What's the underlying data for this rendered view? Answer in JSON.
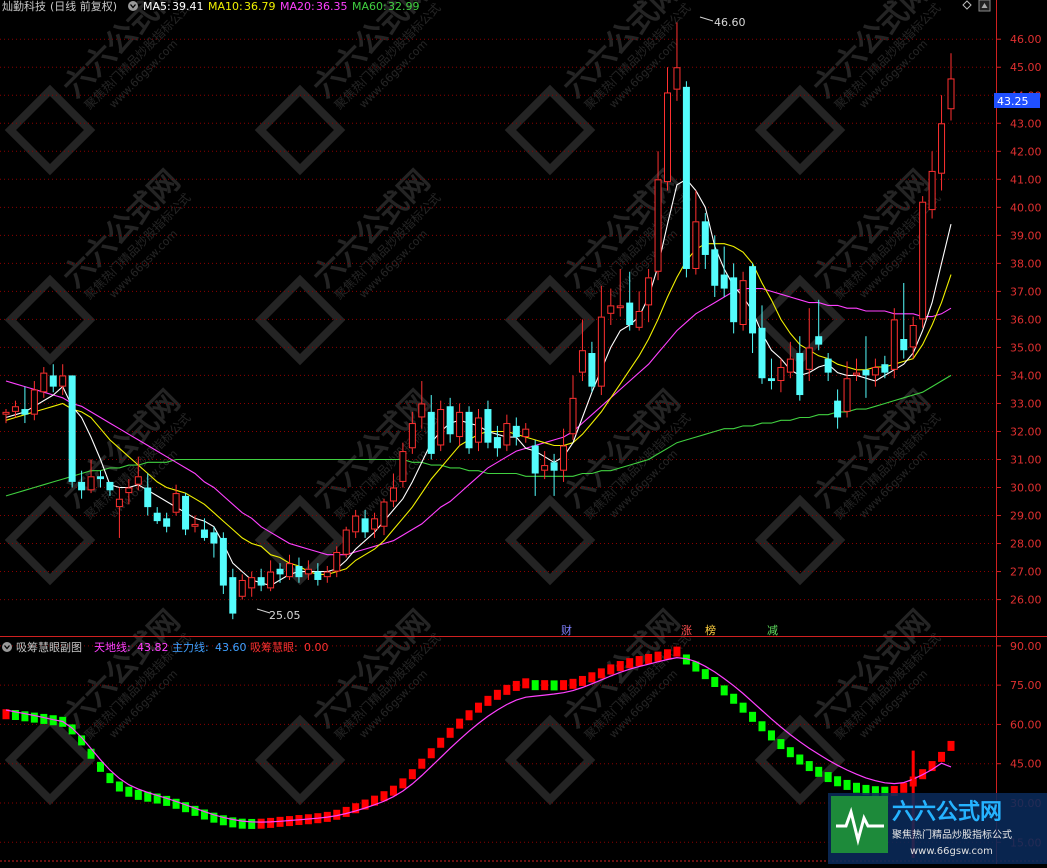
{
  "main_header": {
    "stock_name": "灿勤科技",
    "period": "(日线 前复权)",
    "ma": [
      {
        "label": "MA5:",
        "value": "39.41",
        "color": "#ffffff"
      },
      {
        "label": "MA10:",
        "value": "36.79",
        "color": "#f0f000"
      },
      {
        "label": "MA20:",
        "value": "36.35",
        "color": "#ff40ff"
      },
      {
        "label": "MA60:",
        "value": "32.99",
        "color": "#40d040"
      }
    ]
  },
  "sub_header": {
    "title": "吸筹慧眼副图",
    "items": [
      {
        "label": "天地线:",
        "value": "43.82",
        "color": "#ff40ff"
      },
      {
        "label": "主力线:",
        "value": "43.60",
        "color": "#40a0ff"
      },
      {
        "label": "吸筹慧眼:",
        "value": "0.00",
        "color": "#ff3030"
      }
    ]
  },
  "current_price_tag": "43.25",
  "annotations": {
    "high": "46.60",
    "low": "25.05",
    "markers": [
      "财",
      "涨",
      "榜",
      "减"
    ]
  },
  "watermark": {
    "brand": "六六公式网",
    "slogan": "聚焦热门精品炒股指标公式",
    "url": "www.66gsw.com"
  },
  "colors": {
    "up": "#ff3030",
    "down": "#54fcfc",
    "grid": "#8b0000",
    "axis": "#d02020",
    "ma5": "#ffffff",
    "ma10": "#f0f000",
    "ma20": "#ff40ff",
    "ma60": "#40d040",
    "sub_up": "#ff0000",
    "sub_down": "#00ff00"
  },
  "chart_data": [
    {
      "type": "candlestick",
      "title": "灿勤科技",
      "ylim": [
        24.7,
        46.9
      ],
      "y_ticks": [
        "26.00",
        "27.00",
        "28.00",
        "29.00",
        "30.00",
        "31.00",
        "32.00",
        "33.00",
        "34.00",
        "35.00",
        "36.00",
        "37.00",
        "38.00",
        "39.00",
        "40.00",
        "41.00",
        "42.00",
        "43.00",
        "44.00",
        "45.00",
        "46.00"
      ],
      "candles": [
        [
          32.6,
          32.7,
          32.3,
          32.8
        ],
        [
          32.7,
          32.9,
          32.5,
          33.1
        ],
        [
          32.8,
          32.6,
          32.3,
          33.6
        ],
        [
          32.6,
          33.5,
          32.4,
          33.8
        ],
        [
          33.4,
          34.1,
          33.2,
          34.3
        ],
        [
          34.0,
          33.6,
          33.4,
          34.4
        ],
        [
          33.6,
          34.0,
          33.3,
          34.4
        ],
        [
          34.0,
          30.2,
          30.0,
          34.0
        ],
        [
          30.2,
          29.9,
          29.6,
          30.6
        ],
        [
          29.9,
          30.4,
          29.8,
          31.0
        ],
        [
          30.4,
          30.3,
          30.0,
          30.6
        ],
        [
          30.2,
          29.9,
          29.7,
          30.1
        ],
        [
          29.3,
          29.6,
          28.2,
          30.0
        ],
        [
          29.8,
          30.0,
          29.4,
          30.3
        ],
        [
          30.1,
          30.4,
          29.9,
          31.1
        ],
        [
          30.0,
          29.3,
          29.0,
          30.5
        ],
        [
          29.1,
          28.8,
          28.7,
          29.3
        ],
        [
          28.9,
          28.6,
          28.4,
          29.1
        ],
        [
          29.1,
          29.8,
          29.0,
          30.1
        ],
        [
          29.7,
          28.5,
          28.3,
          29.8
        ],
        [
          28.6,
          28.7,
          28.4,
          29.0
        ],
        [
          28.5,
          28.2,
          28.1,
          28.9
        ],
        [
          28.4,
          28.0,
          27.5,
          28.6
        ],
        [
          28.2,
          26.5,
          26.2,
          28.4
        ],
        [
          26.8,
          25.5,
          25.3,
          27.1
        ],
        [
          26.1,
          26.7,
          26.0,
          26.9
        ],
        [
          26.4,
          26.8,
          26.1,
          27.0
        ],
        [
          26.8,
          26.5,
          26.3,
          27.1
        ],
        [
          26.4,
          27.0,
          26.3,
          27.4
        ],
        [
          27.1,
          26.9,
          26.6,
          27.3
        ],
        [
          26.8,
          27.3,
          26.7,
          27.6
        ],
        [
          27.2,
          26.8,
          26.6,
          27.5
        ],
        [
          26.9,
          27.1,
          26.7,
          27.4
        ],
        [
          27.0,
          26.7,
          26.5,
          27.3
        ],
        [
          26.8,
          27.0,
          26.6,
          27.2
        ],
        [
          27.0,
          27.7,
          26.8,
          27.9
        ],
        [
          27.6,
          28.5,
          27.5,
          28.6
        ],
        [
          28.4,
          29.0,
          28.2,
          29.2
        ],
        [
          28.9,
          28.4,
          28.2,
          29.2
        ],
        [
          28.5,
          28.9,
          28.2,
          29.1
        ],
        [
          28.6,
          29.5,
          28.3,
          29.6
        ],
        [
          29.5,
          30.0,
          29.3,
          30.5
        ],
        [
          30.2,
          31.3,
          30.0,
          31.6
        ],
        [
          31.4,
          32.3,
          31.2,
          32.7
        ],
        [
          32.5,
          33.0,
          32.1,
          33.8
        ],
        [
          32.7,
          31.2,
          31.0,
          33.3
        ],
        [
          31.5,
          32.8,
          31.3,
          33.1
        ],
        [
          32.9,
          31.9,
          31.6,
          33.2
        ],
        [
          31.8,
          32.7,
          31.5,
          33.0
        ],
        [
          32.7,
          31.4,
          31.2,
          32.9
        ],
        [
          31.6,
          32.5,
          31.3,
          32.8
        ],
        [
          32.8,
          31.6,
          31.4,
          33.1
        ],
        [
          31.8,
          31.4,
          31.1,
          32.2
        ],
        [
          31.5,
          32.3,
          31.3,
          32.6
        ],
        [
          32.2,
          31.8,
          31.5,
          32.5
        ],
        [
          31.8,
          32.1,
          31.6,
          32.3
        ],
        [
          31.5,
          30.5,
          29.7,
          31.7
        ],
        [
          30.6,
          30.8,
          30.3,
          31.3
        ],
        [
          30.9,
          30.6,
          29.7,
          31.2
        ],
        [
          30.6,
          31.5,
          30.2,
          32.1
        ],
        [
          31.9,
          33.2,
          31.7,
          34.0
        ],
        [
          34.1,
          34.9,
          33.8,
          36.0
        ],
        [
          34.8,
          33.6,
          33.4,
          35.2
        ],
        [
          33.6,
          36.1,
          33.3,
          37.2
        ],
        [
          36.2,
          36.5,
          35.8,
          37.1
        ],
        [
          36.4,
          36.5,
          36.1,
          37.8
        ],
        [
          36.6,
          35.8,
          35.6,
          37.7
        ],
        [
          35.7,
          36.3,
          35.6,
          37.0
        ],
        [
          36.5,
          37.5,
          35.9,
          37.8
        ],
        [
          37.7,
          41.0,
          37.4,
          42.0
        ],
        [
          40.9,
          44.1,
          40.6,
          45.0
        ],
        [
          44.2,
          45.0,
          43.8,
          46.6
        ],
        [
          44.3,
          37.8,
          37.5,
          44.5
        ],
        [
          37.8,
          39.5,
          37.6,
          40.6
        ],
        [
          39.5,
          38.3,
          37.8,
          39.8
        ],
        [
          38.5,
          37.2,
          36.8,
          39.0
        ],
        [
          37.6,
          37.1,
          36.8,
          38.6
        ],
        [
          37.5,
          35.9,
          35.5,
          38.0
        ],
        [
          35.8,
          37.4,
          35.6,
          37.7
        ],
        [
          37.9,
          35.5,
          34.8,
          38.0
        ],
        [
          35.7,
          33.9,
          33.7,
          36.5
        ],
        [
          33.9,
          33.8,
          33.5,
          34.6
        ],
        [
          33.8,
          34.3,
          33.4,
          34.6
        ],
        [
          34.1,
          34.6,
          33.9,
          35.2
        ],
        [
          34.8,
          33.3,
          33.1,
          35.4
        ],
        [
          34.2,
          35.0,
          33.8,
          36.4
        ],
        [
          35.4,
          35.1,
          34.9,
          36.7
        ],
        [
          34.6,
          34.1,
          33.8,
          34.8
        ],
        [
          33.1,
          32.5,
          32.1,
          33.5
        ],
        [
          32.7,
          33.9,
          32.5,
          34.5
        ],
        [
          34.0,
          34.1,
          33.8,
          34.6
        ],
        [
          34.2,
          34.0,
          33.2,
          35.4
        ],
        [
          34.0,
          34.3,
          33.6,
          34.6
        ],
        [
          34.4,
          34.1,
          33.9,
          34.7
        ],
        [
          34.2,
          36.0,
          33.9,
          36.4
        ],
        [
          35.3,
          34.9,
          34.6,
          37.3
        ],
        [
          35.0,
          35.8,
          34.6,
          36.1
        ],
        [
          36.0,
          40.2,
          35.7,
          40.4
        ],
        [
          39.9,
          41.3,
          39.6,
          42.0
        ],
        [
          41.2,
          43.0,
          40.6,
          44.0
        ],
        [
          43.5,
          44.6,
          43.1,
          45.5
        ]
      ],
      "ma5": [
        32.5,
        32.6,
        32.7,
        32.9,
        33.1,
        33.3,
        33.6,
        32.9,
        32.5,
        31.8,
        31.0,
        30.1,
        30.0,
        30.0,
        30.1,
        29.9,
        29.7,
        29.5,
        29.3,
        29.1,
        28.9,
        28.8,
        28.6,
        28.0,
        27.3,
        27.0,
        26.7,
        26.6,
        26.5,
        26.7,
        26.9,
        27.0,
        27.0,
        27.0,
        27.0,
        27.1,
        27.4,
        27.8,
        28.1,
        28.4,
        28.8,
        29.2,
        29.6,
        30.2,
        30.9,
        31.6,
        32.0,
        32.3,
        32.4,
        32.3,
        32.2,
        32.0,
        31.9,
        31.8,
        31.8,
        31.4,
        31.3,
        31.1,
        30.9,
        31.1,
        31.6,
        32.5,
        33.4,
        34.2,
        35.0,
        35.6,
        35.8,
        36.1,
        36.8,
        37.9,
        39.4,
        40.8,
        41.0,
        40.6,
        40.0,
        38.6,
        37.8,
        37.2,
        36.8,
        36.3,
        35.5,
        34.9,
        34.6,
        34.2,
        34.0,
        34.1,
        34.3,
        34.4,
        34.1,
        34.0,
        34.0,
        33.9,
        33.8,
        34.0,
        34.2,
        34.4,
        34.8,
        35.6,
        36.6,
        38.0,
        39.4
      ],
      "ma10": [
        32.4,
        32.5,
        32.6,
        32.7,
        32.8,
        32.9,
        33.0,
        32.8,
        32.7,
        32.5,
        32.1,
        31.7,
        31.4,
        31.1,
        30.8,
        30.5,
        30.2,
        30.0,
        29.9,
        29.8,
        29.6,
        29.4,
        29.1,
        28.8,
        28.5,
        28.2,
        28.0,
        27.9,
        27.6,
        27.5,
        27.3,
        27.2,
        27.0,
        26.9,
        26.9,
        27.0,
        27.1,
        27.4,
        27.6,
        27.8,
        28.1,
        28.5,
        28.9,
        29.3,
        29.8,
        30.3,
        30.7,
        31.1,
        31.5,
        31.7,
        31.9,
        32.0,
        32.0,
        32.0,
        31.9,
        31.8,
        31.7,
        31.6,
        31.5,
        31.5,
        31.6,
        31.9,
        32.3,
        32.7,
        33.2,
        33.7,
        34.2,
        34.7,
        35.3,
        36.0,
        36.8,
        37.5,
        38.1,
        38.5,
        38.7,
        38.7,
        38.7,
        38.6,
        38.4,
        38.0,
        37.3,
        36.7,
        36.0,
        35.5,
        35.1,
        34.9,
        34.7,
        34.6,
        34.4,
        34.3,
        34.2,
        34.2,
        34.3,
        34.3,
        34.4,
        34.5,
        34.6,
        35.1,
        35.8,
        36.6,
        37.6
      ],
      "ma20": [
        33.8,
        33.7,
        33.6,
        33.5,
        33.4,
        33.3,
        33.2,
        33.0,
        32.9,
        32.7,
        32.5,
        32.3,
        32.1,
        31.9,
        31.7,
        31.5,
        31.3,
        31.1,
        30.9,
        30.7,
        30.5,
        30.2,
        30.0,
        29.7,
        29.4,
        29.1,
        28.9,
        28.6,
        28.4,
        28.2,
        28.0,
        27.9,
        27.8,
        27.7,
        27.6,
        27.6,
        27.6,
        27.7,
        27.8,
        27.9,
        28.0,
        28.1,
        28.3,
        28.5,
        28.7,
        29.0,
        29.3,
        29.5,
        29.8,
        30.1,
        30.4,
        30.7,
        30.9,
        31.1,
        31.3,
        31.4,
        31.5,
        31.6,
        31.7,
        31.8,
        32.0,
        32.3,
        32.6,
        32.9,
        33.2,
        33.5,
        33.8,
        34.1,
        34.4,
        34.8,
        35.2,
        35.6,
        35.9,
        36.2,
        36.4,
        36.6,
        36.8,
        37.0,
        37.1,
        37.1,
        37.1,
        37.0,
        36.9,
        36.8,
        36.7,
        36.6,
        36.6,
        36.5,
        36.5,
        36.4,
        36.4,
        36.3,
        36.3,
        36.3,
        36.2,
        36.2,
        36.2,
        36.1,
        36.1,
        36.2,
        36.4
      ],
      "ma60": [
        29.7,
        29.8,
        29.9,
        30.0,
        30.1,
        30.2,
        30.3,
        30.4,
        30.5,
        30.6,
        30.6,
        30.7,
        30.7,
        30.8,
        30.8,
        30.9,
        30.9,
        30.9,
        31.0,
        31.0,
        31.0,
        31.0,
        31.0,
        31.0,
        31.0,
        31.0,
        31.0,
        31.0,
        31.0,
        31.0,
        31.0,
        31.0,
        31.0,
        31.0,
        31.0,
        31.0,
        31.0,
        31.0,
        31.0,
        31.0,
        31.0,
        31.0,
        31.0,
        30.9,
        30.9,
        30.8,
        30.8,
        30.7,
        30.7,
        30.6,
        30.6,
        30.5,
        30.5,
        30.5,
        30.5,
        30.4,
        30.4,
        30.4,
        30.4,
        30.4,
        30.4,
        30.5,
        30.5,
        30.6,
        30.6,
        30.7,
        30.8,
        30.9,
        31.0,
        31.2,
        31.4,
        31.6,
        31.7,
        31.8,
        31.9,
        32.0,
        32.1,
        32.1,
        32.2,
        32.2,
        32.3,
        32.3,
        32.4,
        32.4,
        32.5,
        32.5,
        32.6,
        32.6,
        32.7,
        32.7,
        32.8,
        32.8,
        32.9,
        33.0,
        33.1,
        33.2,
        33.3,
        33.4,
        33.6,
        33.8,
        34.0
      ]
    },
    {
      "type": "bar",
      "title": "吸筹慧眼副图",
      "ylim": [
        9,
        93
      ],
      "y_ticks": [
        "15.00",
        "30.00",
        "45.00",
        "60.00",
        "75.00",
        "90.00"
      ],
      "bars": [
        63.9,
        63.6,
        63.1,
        62.6,
        62.1,
        61.6,
        61.0,
        58.1,
        53.9,
        48.8,
        43.8,
        39.5,
        36.3,
        34.3,
        33.1,
        32.4,
        31.7,
        30.8,
        29.7,
        28.4,
        27.0,
        25.6,
        24.4,
        23.4,
        22.6,
        22.1,
        22.0,
        22.1,
        22.4,
        22.8,
        23.1,
        23.5,
        23.8,
        24.2,
        24.7,
        25.5,
        26.6,
        28.0,
        29.4,
        30.9,
        32.6,
        34.7,
        37.5,
        41.0,
        45.0,
        49.0,
        53.0,
        56.8,
        60.3,
        63.5,
        66.4,
        69.0,
        71.3,
        73.2,
        74.7,
        75.7,
        75.0,
        75.0,
        74.9,
        75.0,
        75.5,
        76.6,
        78.0,
        79.5,
        81.0,
        82.3,
        83.4,
        84.2,
        85.0,
        85.9,
        86.8,
        87.8,
        84.8,
        82.1,
        79.2,
        76.2,
        73.0,
        69.8,
        66.4,
        62.9,
        59.3,
        55.8,
        52.5,
        49.4,
        46.6,
        44.1,
        41.9,
        39.9,
        38.3,
        36.9,
        35.8,
        35.0,
        34.5,
        34.3,
        34.6,
        35.8,
        38.2,
        41.0,
        44.1,
        47.6,
        51.8
      ],
      "main_line": [
        65.5,
        64.8,
        64.1,
        63.4,
        62.6,
        61.8,
        61.1,
        58.6,
        55.0,
        50.8,
        46.5,
        42.6,
        39.4,
        37.0,
        35.3,
        34.0,
        32.9,
        31.8,
        30.6,
        29.3,
        28.0,
        26.7,
        25.5,
        24.5,
        23.7,
        23.1,
        22.8,
        22.7,
        22.8,
        23.0,
        23.3,
        23.6,
        23.9,
        24.2,
        24.6,
        25.2,
        26.0,
        27.0,
        28.1,
        29.3,
        30.7,
        32.4,
        34.6,
        37.3,
        40.5,
        43.9,
        47.4,
        50.9,
        54.2,
        57.4,
        60.4,
        63.1,
        65.5,
        67.6,
        69.3,
        70.4,
        70.8,
        71.2,
        71.6,
        72.1,
        72.9,
        74.1,
        75.5,
        77.0,
        78.5,
        79.9,
        81.1,
        82.1,
        83.0,
        83.9,
        84.8,
        85.5,
        85.1,
        84.0,
        82.2,
        80.0,
        77.5,
        74.8,
        71.8,
        68.6,
        65.3,
        62.1,
        59.0,
        56.1,
        53.4,
        50.9,
        48.6,
        46.4,
        44.4,
        42.6,
        41.0,
        39.6,
        38.5,
        37.7,
        37.4,
        37.8,
        39.1,
        40.8,
        42.8,
        45.2,
        43.8
      ],
      "signal_spikes": [
        {
          "index": 96,
          "value": 50.0
        }
      ]
    }
  ]
}
